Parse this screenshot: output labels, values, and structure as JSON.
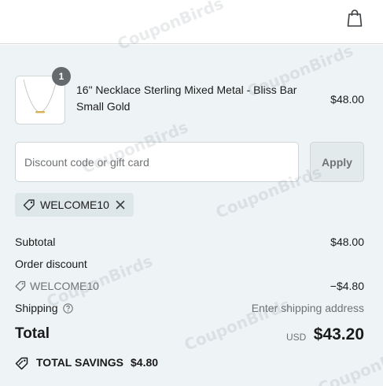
{
  "header": {
    "cart_icon": "shopping-bag-icon"
  },
  "cart": {
    "items": [
      {
        "name": "16\" Necklace Sterling Mixed Metal - Bliss Bar Small Gold",
        "price": "$48.00",
        "quantity": "1"
      }
    ]
  },
  "discount": {
    "placeholder": "Discount code or gift card",
    "value": "",
    "apply_label": "Apply",
    "applied_code": "WELCOME10"
  },
  "totals": {
    "subtotal_label": "Subtotal",
    "subtotal_value": "$48.00",
    "order_discount_label": "Order discount",
    "discount_code": "WELCOME10",
    "discount_value": "−$4.80",
    "shipping_label": "Shipping",
    "shipping_value": "Enter shipping address",
    "total_label": "Total",
    "total_currency": "USD",
    "total_value": "$43.20",
    "savings_label": "TOTAL SAVINGS",
    "savings_value": "$4.80"
  },
  "watermark": "CouponBirds",
  "colors": {
    "summary_bg": "#eef4f6",
    "tag_bg": "#dde6e9",
    "muted_text": "#6f7375"
  }
}
